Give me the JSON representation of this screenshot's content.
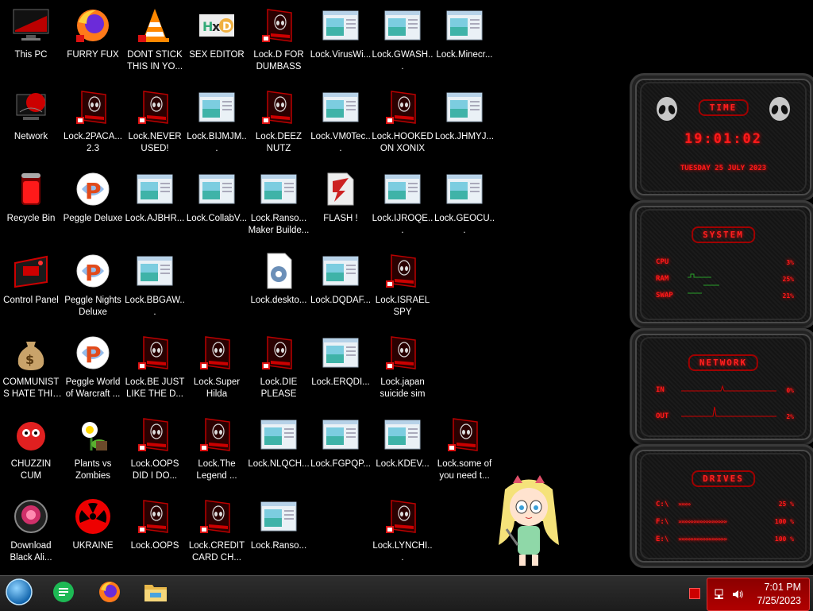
{
  "colors": {
    "accent_red": "#ff1a1a",
    "tray_red": "#b00000",
    "desktop": "#000000"
  },
  "desktop": {
    "icons": [
      {
        "label": "This PC",
        "icon": "monitor-red-icon"
      },
      {
        "label": "FURRY FUX",
        "icon": "firefox-icon"
      },
      {
        "label": "DONT STICK THIS IN YO...",
        "icon": "vlc-cone-icon"
      },
      {
        "label": "SEX EDITOR",
        "icon": "hxd-editor-icon"
      },
      {
        "label": "Lock.D FOR DUMBASS",
        "icon": "alien-lock-icon"
      },
      {
        "label": "Lock.VirusWi...",
        "icon": "window-app-icon"
      },
      {
        "label": "Lock.GWASH...",
        "icon": "window-app-icon"
      },
      {
        "label": "Lock.Minecr...",
        "icon": "window-app-icon"
      },
      {
        "label": "Network",
        "icon": "network-monitor-icon"
      },
      {
        "label": "Lock.2PACA... 2.3",
        "icon": "alien-lock-icon"
      },
      {
        "label": "Lock.NEVER USED!",
        "icon": "alien-lock-icon"
      },
      {
        "label": "Lock.BIJMJM...",
        "icon": "window-app-icon"
      },
      {
        "label": "Lock.DEEZ NUTZ",
        "icon": "alien-lock-icon"
      },
      {
        "label": "Lock.VM0Tec...",
        "icon": "window-app-icon"
      },
      {
        "label": "Lock.HOOKED ON XONIX",
        "icon": "alien-lock-icon"
      },
      {
        "label": "Lock.JHMYJ...",
        "icon": "window-app-icon"
      },
      {
        "label": "Recycle Bin",
        "icon": "recycle-bin-red-icon"
      },
      {
        "label": "Peggle Deluxe",
        "icon": "peggle-icon"
      },
      {
        "label": "Lock.AJBHR...",
        "icon": "window-app-icon"
      },
      {
        "label": "Lock.CollabV...",
        "icon": "window-app-icon"
      },
      {
        "label": "Lock.Ranso... Maker Builde...",
        "icon": "window-app-icon"
      },
      {
        "label": "FLASH !",
        "icon": "flash-file-icon"
      },
      {
        "label": "Lock.IJROQE...",
        "icon": "window-app-icon"
      },
      {
        "label": "Lock.GEOCU...",
        "icon": "window-app-icon"
      },
      {
        "label": "Control Panel",
        "icon": "control-panel-red-icon"
      },
      {
        "label": "Peggle Nights Deluxe",
        "icon": "peggle-icon"
      },
      {
        "label": "Lock.BBGAW...",
        "icon": "window-app-icon"
      },
      {
        "label": "Lock.deskto...",
        "icon": "settings-file-icon"
      },
      {
        "label": "Lock.DQDAF...",
        "icon": "window-app-icon"
      },
      {
        "label": "Lock.ISRAEL SPY",
        "icon": "alien-lock-icon"
      },
      {
        "label": "COMMUNISTS HATE THIS G...",
        "icon": "money-bag-icon"
      },
      {
        "label": "Peggle World of Warcraft ...",
        "icon": "peggle-icon"
      },
      {
        "label": "Lock.BE JUST LIKE THE D...",
        "icon": "alien-lock-icon"
      },
      {
        "label": "Lock.Super Hilda",
        "icon": "alien-lock-icon"
      },
      {
        "label": "Lock.DIE PLEASE",
        "icon": "alien-lock-icon"
      },
      {
        "label": "Lock.ERQDI...",
        "icon": "window-app-icon"
      },
      {
        "label": "Lock.japan suicide sim",
        "icon": "alien-lock-icon"
      },
      {
        "label": "CHUZZIN CUM",
        "icon": "chuzzle-icon"
      },
      {
        "label": "Plants vs Zombies",
        "icon": "pvz-flower-icon"
      },
      {
        "label": "Lock.OOPS DID I DO...",
        "icon": "alien-lock-icon"
      },
      {
        "label": "Lock.The Legend ...",
        "icon": "alien-lock-icon"
      },
      {
        "label": "Lock.NLQCH...",
        "icon": "window-app-icon"
      },
      {
        "label": "Lock.FGPQP...",
        "icon": "window-app-icon"
      },
      {
        "label": "Lock.KDEV...",
        "icon": "window-app-icon"
      },
      {
        "label": "Lock.some of you need t...",
        "icon": "alien-lock-icon"
      },
      {
        "label": "Download Black Ali...",
        "icon": "black-alien-orb-icon"
      },
      {
        "label": "UKRAINE",
        "icon": "radiation-icon"
      },
      {
        "label": "Lock.OOPS",
        "icon": "alien-lock-icon"
      },
      {
        "label": "Lock.CREDIT CARD CH...",
        "icon": "alien-lock-icon"
      },
      {
        "label": "Lock.Ranso...",
        "icon": "window-app-icon"
      },
      {
        "label": "Lock.LYNCHI...",
        "icon": "alien-lock-icon"
      }
    ]
  },
  "widgets": {
    "time": {
      "title": "TIME",
      "clock": "19:01:02",
      "date": "TUESDAY 25 JULY 2023"
    },
    "system": {
      "title": "SYSTEM",
      "rows": [
        {
          "label": "CPU",
          "value": "3%"
        },
        {
          "label": "RAM",
          "value": "25%"
        },
        {
          "label": "SWAP",
          "value": "21%"
        }
      ]
    },
    "network": {
      "title": "NETWORK",
      "rows": [
        {
          "label": "IN",
          "value": "0%"
        },
        {
          "label": "OUT",
          "value": "2%"
        }
      ]
    },
    "drives": {
      "title": "DRIVES",
      "rows": [
        {
          "label": "C:\\",
          "arrows": "»»»»",
          "value": "25 %"
        },
        {
          "label": "F:\\",
          "arrows": "»»»»»»»»»»»»»»»»",
          "value": "100 %"
        },
        {
          "label": "E:\\",
          "arrows": "»»»»»»»»»»»»»»»»",
          "value": "100 %"
        }
      ]
    }
  },
  "taskbar": {
    "apps": [
      {
        "name": "start-orb-icon"
      },
      {
        "name": "chat-app-icon"
      },
      {
        "name": "firefox-icon"
      },
      {
        "name": "file-explorer-icon"
      }
    ],
    "tray": {
      "time": "7:01 PM",
      "date": "7/25/2023",
      "icons": [
        "network-icon",
        "volume-icon"
      ]
    }
  }
}
